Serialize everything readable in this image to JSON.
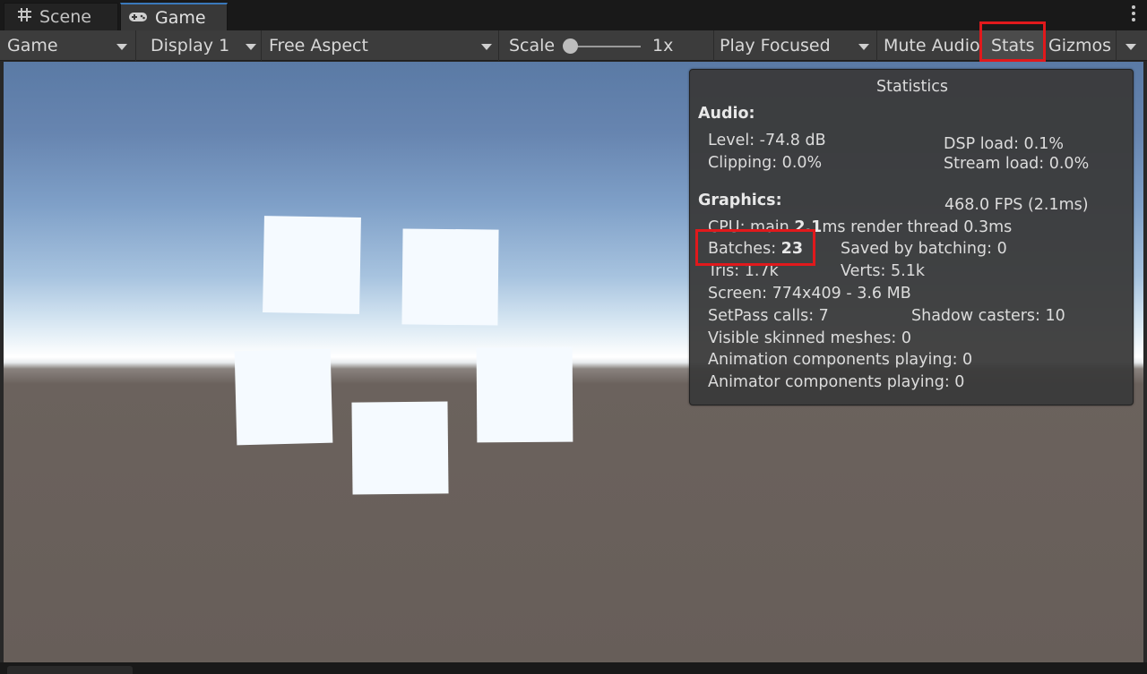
{
  "tabs": [
    {
      "label": "Scene",
      "icon": "grid-hash-icon"
    },
    {
      "label": "Game",
      "icon": "gamepad-icon"
    }
  ],
  "toolbar": {
    "game_mode": "Game",
    "display": "Display 1",
    "aspect": "Free Aspect",
    "scale_label": "Scale",
    "scale_value": "1x",
    "play_mode": "Play Focused",
    "mute_audio": "Mute Audio",
    "stats": "Stats",
    "gizmos": "Gizmos"
  },
  "statistics": {
    "title": "Statistics",
    "audio": {
      "heading": "Audio:",
      "level": "Level: -74.8 dB",
      "clipping": "Clipping: 0.0%",
      "dsp_load": "DSP load: 0.1%",
      "stream_load": "Stream load: 0.0%"
    },
    "graphics": {
      "heading": "Graphics:",
      "fps": "468.0 FPS (2.1ms)",
      "cpu_label": "CPU: main ",
      "cpu_main": "2.1",
      "cpu_rest": "ms  render thread 0.3ms",
      "batches_label": "Batches: ",
      "batches_value": "23",
      "saved_by_batching": "Saved by batching: 0",
      "tris": "Tris: 1.7k",
      "verts": "Verts: 5.1k",
      "screen": "Screen: 774x409 - 3.6 MB",
      "setpass": "SetPass calls: 7",
      "shadow_casters": "Shadow casters: 10",
      "skinned_meshes": "Visible skinned meshes: 0",
      "animation_components": "Animation components playing: 0",
      "animator_components": "Animator components playing: 0"
    }
  },
  "highlight_color": "#e1191c",
  "accent_color": "#3a79bb"
}
